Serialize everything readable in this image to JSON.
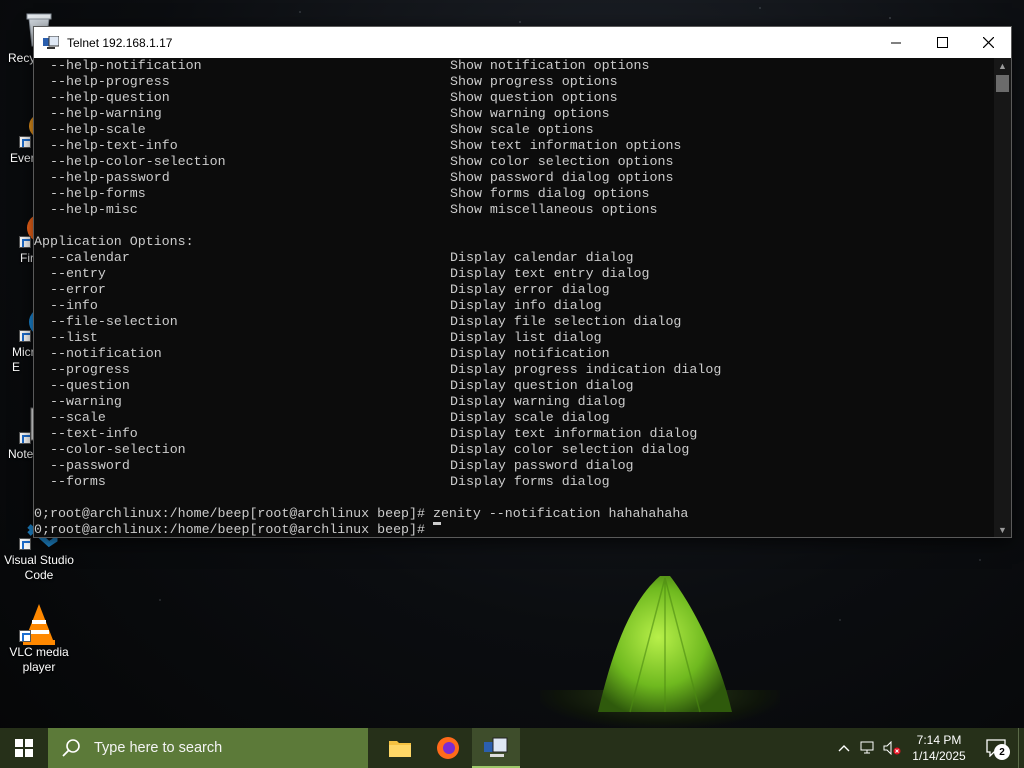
{
  "window": {
    "title": "Telnet 192.168.1.17"
  },
  "terminal": {
    "help_lines": [
      {
        "opt": "--help-notification",
        "desc": "Show notification options"
      },
      {
        "opt": "--help-progress",
        "desc": "Show progress options"
      },
      {
        "opt": "--help-question",
        "desc": "Show question options"
      },
      {
        "opt": "--help-warning",
        "desc": "Show warning options"
      },
      {
        "opt": "--help-scale",
        "desc": "Show scale options"
      },
      {
        "opt": "--help-text-info",
        "desc": "Show text information options"
      },
      {
        "opt": "--help-color-selection",
        "desc": "Show color selection options"
      },
      {
        "opt": "--help-password",
        "desc": "Show password dialog options"
      },
      {
        "opt": "--help-forms",
        "desc": "Show forms dialog options"
      },
      {
        "opt": "--help-misc",
        "desc": "Show miscellaneous options"
      }
    ],
    "app_options_header": "Application Options:",
    "app_lines": [
      {
        "opt": "--calendar",
        "desc": "Display calendar dialog"
      },
      {
        "opt": "--entry",
        "desc": "Display text entry dialog"
      },
      {
        "opt": "--error",
        "desc": "Display error dialog"
      },
      {
        "opt": "--info",
        "desc": "Display info dialog"
      },
      {
        "opt": "--file-selection",
        "desc": "Display file selection dialog"
      },
      {
        "opt": "--list",
        "desc": "Display list dialog"
      },
      {
        "opt": "--notification",
        "desc": "Display notification"
      },
      {
        "opt": "--progress",
        "desc": "Display progress indication dialog"
      },
      {
        "opt": "--question",
        "desc": "Display question dialog"
      },
      {
        "opt": "--warning",
        "desc": "Display warning dialog"
      },
      {
        "opt": "--scale",
        "desc": "Display scale dialog"
      },
      {
        "opt": "--text-info",
        "desc": "Display text information dialog"
      },
      {
        "opt": "--color-selection",
        "desc": "Display color selection dialog"
      },
      {
        "opt": "--password",
        "desc": "Display password dialog"
      },
      {
        "opt": "--forms",
        "desc": "Display forms dialog"
      }
    ],
    "prompt_line_1": "0;root@archlinux:/home/beep[root@archlinux beep]# zenity --notification hahahahaha",
    "prompt_line_2": "0;root@archlinux:/home/beep[root@archlinux beep]# "
  },
  "desktop_icons": [
    {
      "label": "Recy",
      "icon": "recycle-bin-icon"
    },
    {
      "label": "Ever",
      "icon": "everything-icon"
    },
    {
      "label": "Fir",
      "icon": "firefox-icon"
    },
    {
      "label": "Micr\nE",
      "icon": "edge-icon"
    },
    {
      "label": "Note",
      "icon": "notepad-icon"
    },
    {
      "label": "Visual Studio\nCode",
      "icon": "vscode-icon"
    },
    {
      "label": "VLC media\nplayer",
      "icon": "vlc-icon"
    }
  ],
  "taskbar": {
    "search_placeholder": "Type here to search",
    "time": "7:14 PM",
    "date": "1/14/2025",
    "notification_count": "2"
  },
  "colors": {
    "taskbar": "#263019",
    "search": "#5c7a39",
    "terminal_bg": "#0c0c0c",
    "terminal_fg": "#cccccc"
  }
}
